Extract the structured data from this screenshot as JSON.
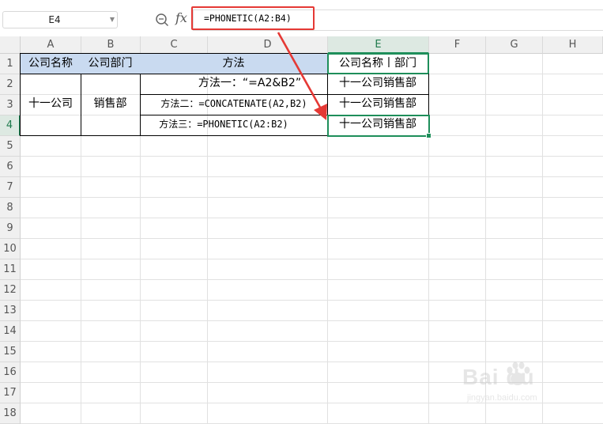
{
  "formula_bar": {
    "name_box": "E4",
    "fx_label": "fx",
    "formula": "=PHONETIC(A2:B4)"
  },
  "columns": [
    "A",
    "B",
    "C",
    "D",
    "E",
    "F",
    "G",
    "H"
  ],
  "rows": [
    "1",
    "2",
    "3",
    "4",
    "5",
    "6",
    "7",
    "8",
    "9",
    "10",
    "11",
    "12",
    "13",
    "14",
    "15",
    "16",
    "17",
    "18"
  ],
  "cells": {
    "A1": "公司名称",
    "B1": "公司部门",
    "C1": "方法",
    "E1": "公司名称丨部门",
    "A2": "十一公司",
    "B2": "销售部",
    "C2": "方法一：“=A2&B2”",
    "C3": "方法二：=CONCATENATE(A2,B2)",
    "C4": "方法三：=PHONETIC(A2:B2)",
    "E2": "十一公司销售部",
    "E3": "十一公司销售部",
    "E4": "十一公司销售部"
  },
  "selection": {
    "active_cell": "E4",
    "column": "E",
    "row": "4"
  },
  "colors": {
    "annotation_red": "#e53935",
    "selection_green": "#1e8e5a",
    "header_fill": "#c9daf0"
  },
  "watermark": {
    "logo": "Bai  du",
    "sub": "jingyan.baidu.com"
  }
}
